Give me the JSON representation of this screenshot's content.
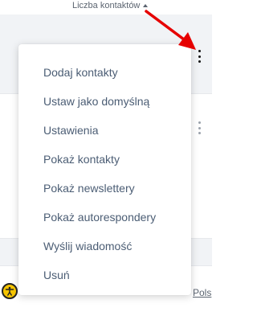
{
  "table": {
    "column_header": "Liczba kontaktów",
    "sort_icon": "chevron-up-icon"
  },
  "context_menu": {
    "items": [
      {
        "label": "Dodaj kontakty"
      },
      {
        "label": "Ustaw jako domyślną"
      },
      {
        "label": "Ustawienia"
      },
      {
        "label": "Pokaż kontakty"
      },
      {
        "label": "Pokaż newslettery"
      },
      {
        "label": "Pokaż autorespondery"
      },
      {
        "label": "Wyślij wiadomość"
      },
      {
        "label": "Usuń"
      }
    ]
  },
  "footer": {
    "accessibility_icon": "accessibility-icon",
    "language_label": "Pols"
  },
  "colors": {
    "menu_text": "#4b5d74",
    "row_grey": "#f1f3f6",
    "annotation_arrow": "#e60000",
    "accessibility_yellow": "#f5c400"
  }
}
